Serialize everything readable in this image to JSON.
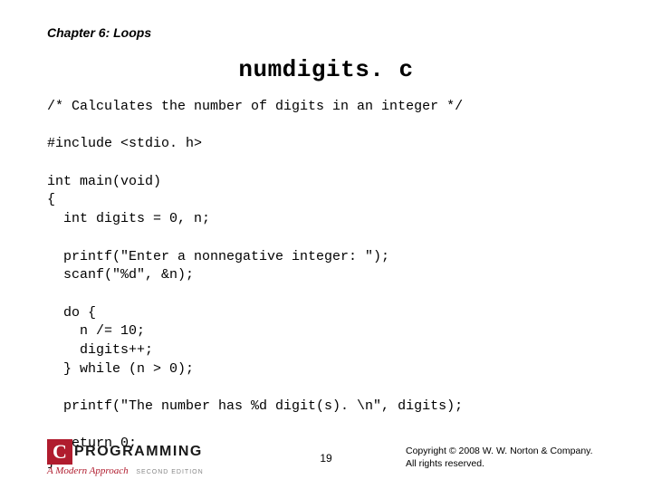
{
  "chapter": "Chapter 6: Loops",
  "title": "numdigits. c",
  "code": "/* Calculates the number of digits in an integer */\n\n#include <stdio. h>\n\nint main(void)\n{\n  int digits = 0, n;\n\n  printf(\"Enter a nonnegative integer: \");\n  scanf(\"%d\", &n);\n\n  do {\n    n /= 10;\n    digits++;\n  } while (n > 0);\n\n  printf(\"The number has %d digit(s). \\n\", digits);\n\n  return 0;\n}",
  "logo": {
    "c": "C",
    "text": "PROGRAMMING",
    "sub": "A Modern Approach",
    "edition": "SECOND EDITION"
  },
  "page": "19",
  "copyright": "Copyright © 2008 W. W. Norton & Company.\nAll rights reserved."
}
